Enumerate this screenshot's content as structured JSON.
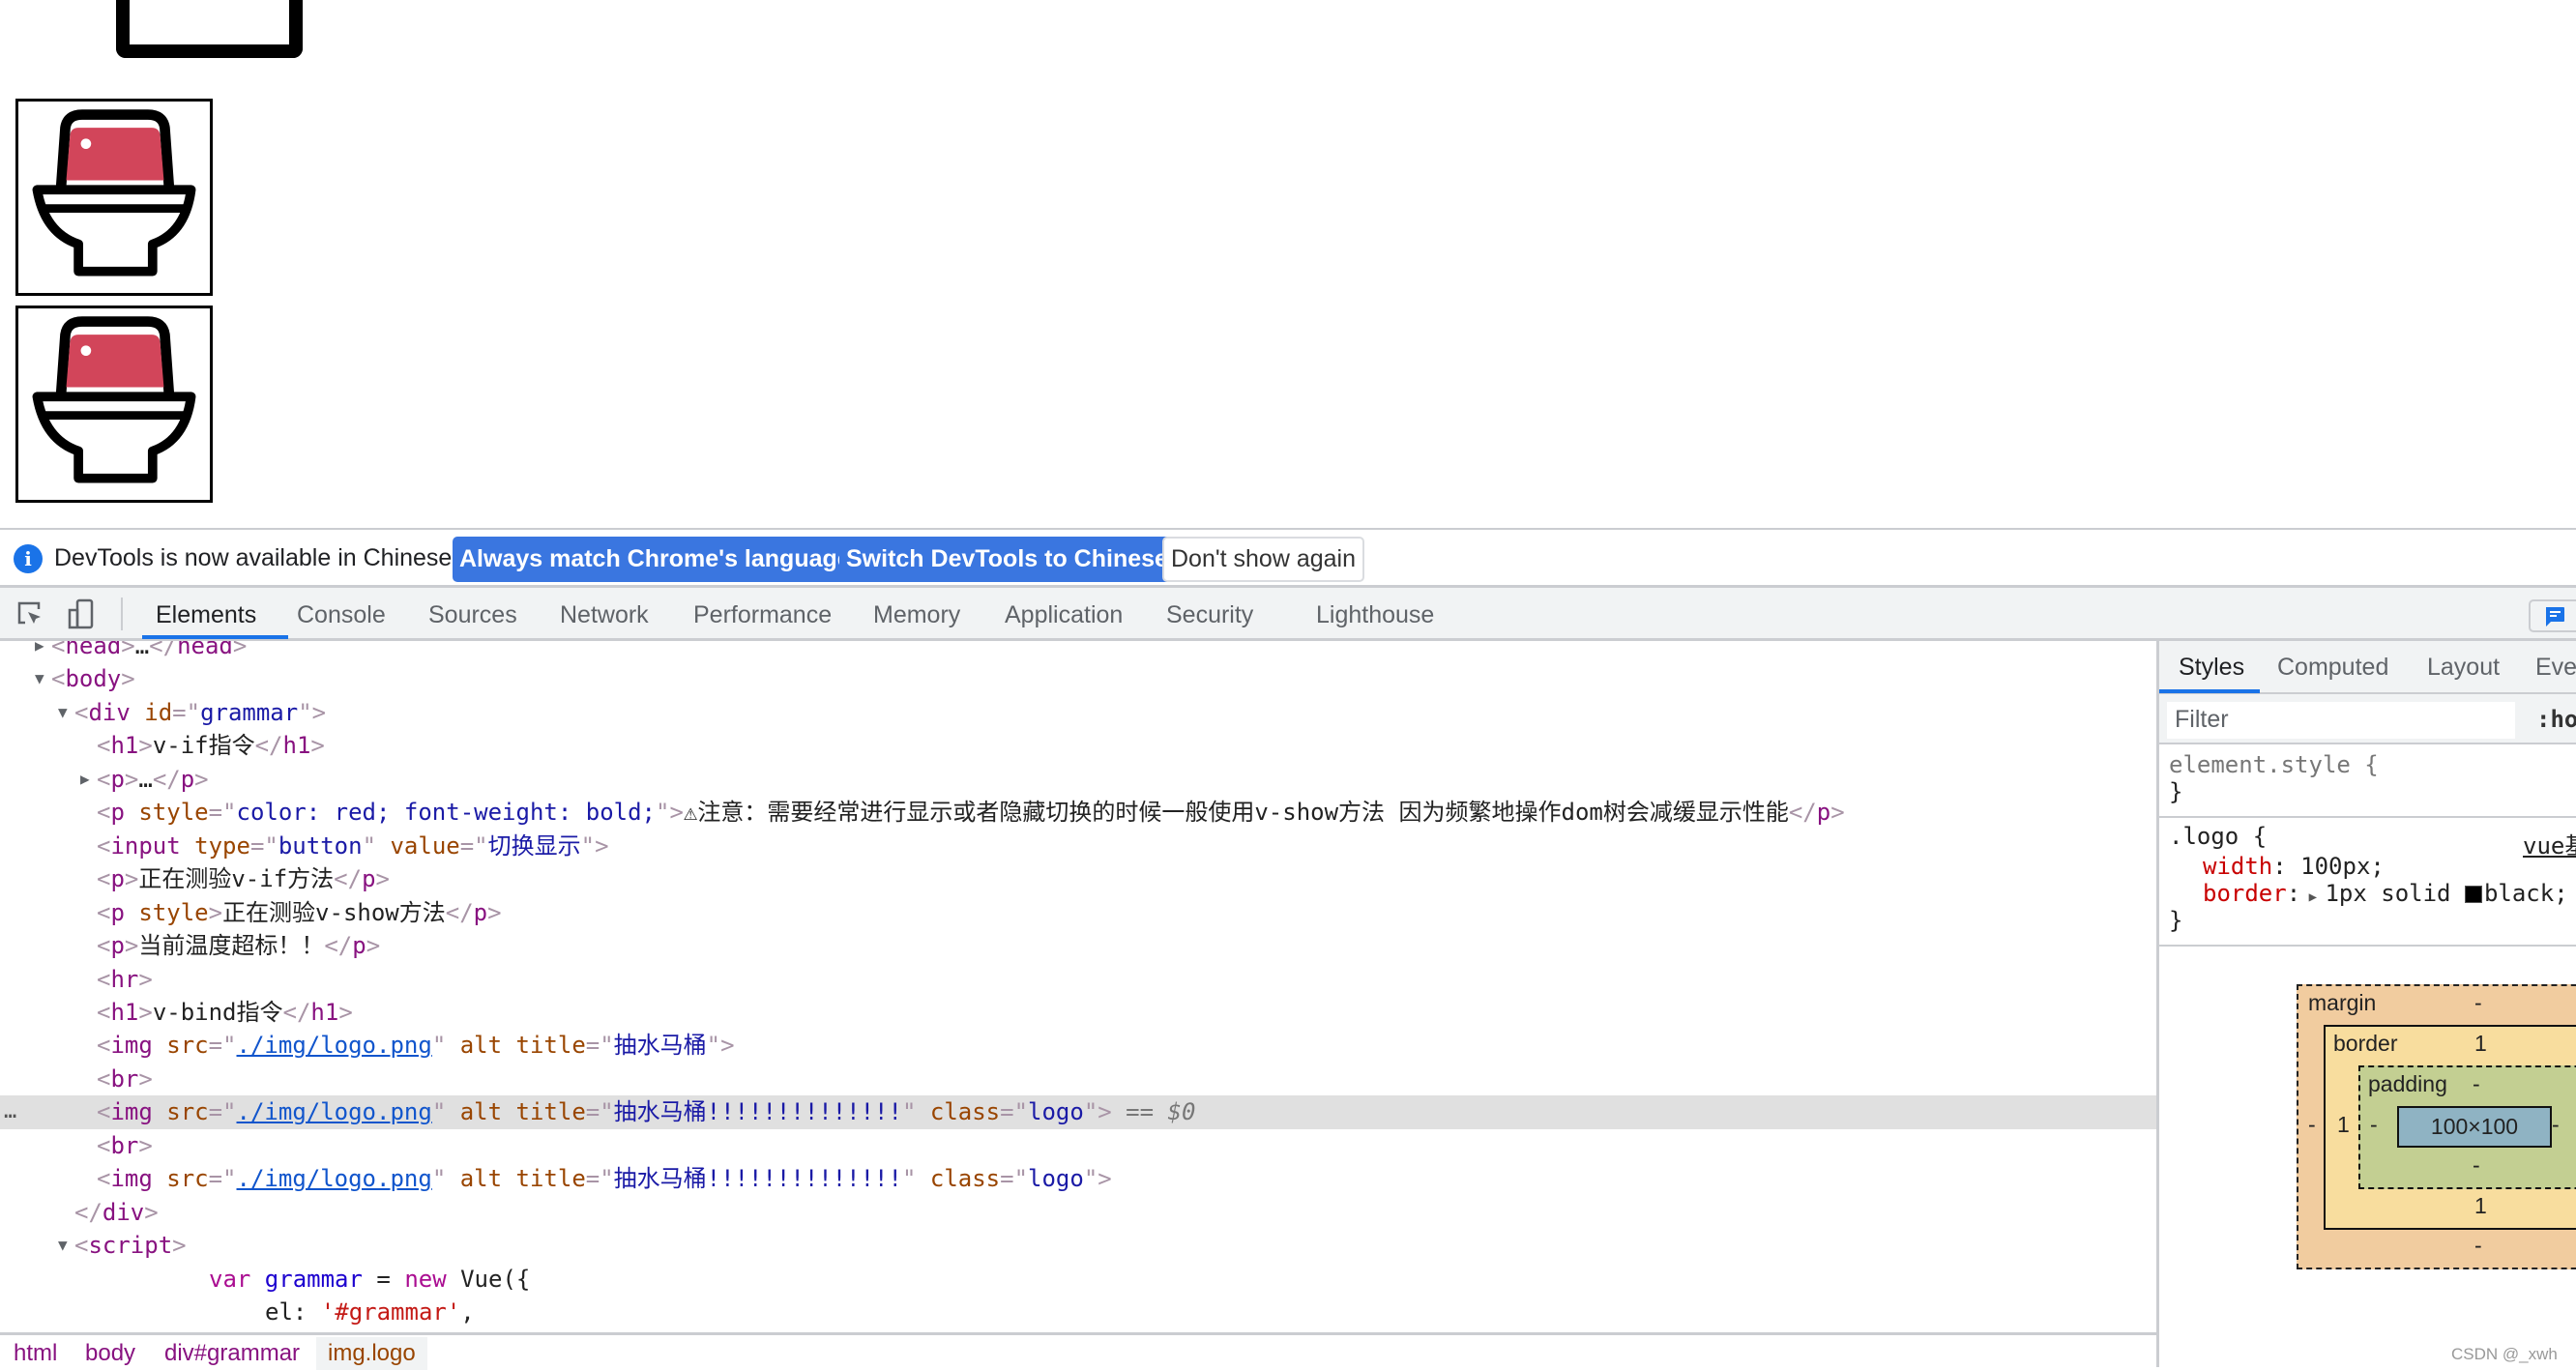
{
  "page": {
    "images": [
      {
        "title": "抽水马桶"
      },
      {
        "title": "抽水马桶!!!!!!!!!!!!!!"
      },
      {
        "title": "抽水马桶!!!!!!!!!!!!!!"
      }
    ],
    "toilet_colors": {
      "tank": "#d2455a",
      "stroke": "#000000"
    }
  },
  "banner": {
    "icon": "info-icon",
    "message": "DevTools is now available in Chinese!",
    "buttons": [
      "Always match Chrome's language",
      "Switch DevTools to Chinese",
      "Don't show again"
    ],
    "accent": "#3a76e0"
  },
  "toolbar": {
    "icons": [
      "inspect-element-icon",
      "device-toolbar-icon"
    ],
    "tabs": [
      "Elements",
      "Console",
      "Sources",
      "Network",
      "Performance",
      "Memory",
      "Application",
      "Security",
      "Lighthouse"
    ],
    "active_tab": "Elements",
    "right_icon": "feedback-chat-icon"
  },
  "dom_tree": {
    "lines": [
      {
        "depth": 0,
        "arrow": "right",
        "parts": [
          [
            "p",
            "<"
          ],
          [
            "tag",
            "head"
          ],
          [
            "p",
            ">"
          ],
          [
            "txt",
            "…"
          ],
          [
            "p",
            "</"
          ],
          [
            "tag",
            "head"
          ],
          [
            "p",
            ">"
          ]
        ]
      },
      {
        "depth": 0,
        "arrow": "down",
        "parts": [
          [
            "p",
            "<"
          ],
          [
            "tag",
            "body"
          ],
          [
            "p",
            ">"
          ]
        ]
      },
      {
        "depth": 1,
        "arrow": "down",
        "parts": [
          [
            "p",
            "<"
          ],
          [
            "tag",
            "div "
          ],
          [
            "an",
            "id"
          ],
          [
            "p",
            "=\""
          ],
          [
            "av",
            "grammar"
          ],
          [
            "p",
            "\">"
          ]
        ]
      },
      {
        "depth": 2,
        "parts": [
          [
            "p",
            "<"
          ],
          [
            "tag",
            "h1"
          ],
          [
            "p",
            ">"
          ],
          [
            "txt",
            "v-if指令"
          ],
          [
            "p",
            "</"
          ],
          [
            "tag",
            "h1"
          ],
          [
            "p",
            ">"
          ]
        ]
      },
      {
        "depth": 2,
        "arrow": "right",
        "parts": [
          [
            "p",
            "<"
          ],
          [
            "tag",
            "p"
          ],
          [
            "p",
            ">"
          ],
          [
            "txt",
            "…"
          ],
          [
            "p",
            "</"
          ],
          [
            "tag",
            "p"
          ],
          [
            "p",
            ">"
          ]
        ]
      },
      {
        "depth": 2,
        "parts": [
          [
            "p",
            "<"
          ],
          [
            "tag",
            "p "
          ],
          [
            "an",
            "style"
          ],
          [
            "p",
            "=\""
          ],
          [
            "av",
            "color: red; font-weight: bold;"
          ],
          [
            "p",
            "\">"
          ],
          [
            "txt",
            "⚠注意：需要经常进行显示或者隐藏切换的时候一般使用v-show方法 因为频繁地操作dom树会减缓显示性能"
          ],
          [
            "p",
            "</"
          ],
          [
            "tag",
            "p"
          ],
          [
            "p",
            ">"
          ]
        ]
      },
      {
        "depth": 2,
        "parts": [
          [
            "p",
            "<"
          ],
          [
            "tag",
            "input "
          ],
          [
            "an",
            "type"
          ],
          [
            "p",
            "=\""
          ],
          [
            "av",
            "button"
          ],
          [
            "p",
            "\" "
          ],
          [
            "an",
            "value"
          ],
          [
            "p",
            "=\""
          ],
          [
            "av",
            "切换显示"
          ],
          [
            "p",
            "\">"
          ]
        ]
      },
      {
        "depth": 2,
        "parts": [
          [
            "p",
            "<"
          ],
          [
            "tag",
            "p"
          ],
          [
            "p",
            ">"
          ],
          [
            "txt",
            "正在测验v-if方法"
          ],
          [
            "p",
            "</"
          ],
          [
            "tag",
            "p"
          ],
          [
            "p",
            ">"
          ]
        ]
      },
      {
        "depth": 2,
        "parts": [
          [
            "p",
            "<"
          ],
          [
            "tag",
            "p "
          ],
          [
            "an",
            "style"
          ],
          [
            "p",
            ">"
          ],
          [
            "txt",
            "正在测验v-show方法"
          ],
          [
            "p",
            "</"
          ],
          [
            "tag",
            "p"
          ],
          [
            "p",
            ">"
          ]
        ]
      },
      {
        "depth": 2,
        "parts": [
          [
            "p",
            "<"
          ],
          [
            "tag",
            "p"
          ],
          [
            "p",
            ">"
          ],
          [
            "txt",
            "当前温度超标！！"
          ],
          [
            "p",
            "</"
          ],
          [
            "tag",
            "p"
          ],
          [
            "p",
            ">"
          ]
        ]
      },
      {
        "depth": 2,
        "parts": [
          [
            "p",
            "<"
          ],
          [
            "tag",
            "hr"
          ],
          [
            "p",
            ">"
          ]
        ]
      },
      {
        "depth": 2,
        "parts": [
          [
            "p",
            "<"
          ],
          [
            "tag",
            "h1"
          ],
          [
            "p",
            ">"
          ],
          [
            "txt",
            "v-bind指令"
          ],
          [
            "p",
            "</"
          ],
          [
            "tag",
            "h1"
          ],
          [
            "p",
            ">"
          ]
        ]
      },
      {
        "depth": 2,
        "parts": [
          [
            "p",
            "<"
          ],
          [
            "tag",
            "img "
          ],
          [
            "an",
            "src"
          ],
          [
            "p",
            "=\""
          ],
          [
            "link",
            "./img/logo.png"
          ],
          [
            "p",
            "\" "
          ],
          [
            "an",
            "alt title"
          ],
          [
            "p",
            "=\""
          ],
          [
            "av",
            "抽水马桶"
          ],
          [
            "p",
            "\">"
          ]
        ]
      },
      {
        "depth": 2,
        "parts": [
          [
            "p",
            "<"
          ],
          [
            "tag",
            "br"
          ],
          [
            "p",
            ">"
          ]
        ]
      },
      {
        "depth": 2,
        "selected": true,
        "parts": [
          [
            "p",
            "<"
          ],
          [
            "tag",
            "img "
          ],
          [
            "an",
            "src"
          ],
          [
            "p",
            "=\""
          ],
          [
            "link",
            "./img/logo.png"
          ],
          [
            "p",
            "\" "
          ],
          [
            "an",
            "alt title"
          ],
          [
            "p",
            "=\""
          ],
          [
            "av",
            "抽水马桶!!!!!!!!!!!!!!"
          ],
          [
            "p",
            "\" "
          ],
          [
            "an",
            "class"
          ],
          [
            "p",
            "=\""
          ],
          [
            "av",
            "logo"
          ],
          [
            "p",
            "\">"
          ],
          [
            "dim",
            " == $0"
          ]
        ]
      },
      {
        "depth": 2,
        "parts": [
          [
            "p",
            "<"
          ],
          [
            "tag",
            "br"
          ],
          [
            "p",
            ">"
          ]
        ]
      },
      {
        "depth": 2,
        "parts": [
          [
            "p",
            "<"
          ],
          [
            "tag",
            "img "
          ],
          [
            "an",
            "src"
          ],
          [
            "p",
            "=\""
          ],
          [
            "link",
            "./img/logo.png"
          ],
          [
            "p",
            "\" "
          ],
          [
            "an",
            "alt title"
          ],
          [
            "p",
            "=\""
          ],
          [
            "av",
            "抽水马桶!!!!!!!!!!!!!!"
          ],
          [
            "p",
            "\" "
          ],
          [
            "an",
            "class"
          ],
          [
            "p",
            "=\""
          ],
          [
            "av",
            "logo"
          ],
          [
            "p",
            "\">"
          ]
        ]
      },
      {
        "depth": 1,
        "parts": [
          [
            "p",
            "</"
          ],
          [
            "tag",
            "div"
          ],
          [
            "p",
            ">"
          ]
        ]
      },
      {
        "depth": 1,
        "arrow": "down",
        "parts": [
          [
            "p",
            "<"
          ],
          [
            "tag",
            "script"
          ],
          [
            "p",
            ">"
          ]
        ]
      },
      {
        "depth": 2,
        "code": 1,
        "parts": [
          [
            "kw",
            "var "
          ],
          [
            "vn",
            "grammar"
          ],
          [
            "txt",
            " = "
          ],
          [
            "kw",
            "new "
          ],
          [
            "txt",
            "Vue({"
          ]
        ]
      },
      {
        "depth": 2,
        "code": 2,
        "parts": [
          [
            "txt",
            "el: "
          ],
          [
            "str",
            "'#grammar'"
          ],
          [
            "txt",
            ","
          ]
        ]
      }
    ],
    "selection_marker": "…"
  },
  "breadcrumbs": [
    "html",
    "body",
    "div#grammar",
    "img.logo"
  ],
  "styles_pane": {
    "tabs": [
      "Styles",
      "Computed",
      "Layout",
      "Even"
    ],
    "active_tab": "Styles",
    "filter_placeholder": "Filter",
    "hov_label": ":hov",
    "element_style": {
      "selector": "element.style {",
      "close": "}"
    },
    "rule": {
      "selector": ".logo {",
      "source": "vue基",
      "props": [
        {
          "name": "width",
          "value": "100px;"
        },
        {
          "name": "border",
          "value": "1px solid ",
          "swatch": "#000000",
          "color_name": "black;"
        }
      ],
      "close": "}"
    },
    "box_model": {
      "margin_label": "margin",
      "margin_top": "-",
      "margin_bottom": "-",
      "margin_left": "-",
      "border_label": "border",
      "border_top": "1",
      "border_bottom": "1",
      "border_left": "1",
      "padding_label": "padding",
      "padding_top": "-",
      "padding_bottom": "-",
      "padding_left": "-",
      "padding_right": "-",
      "content": "100×100",
      "colors": {
        "margin": "#f1cc9f",
        "border": "#f8dd9e",
        "padding": "#c3cf92",
        "content": "#8fb3c3"
      }
    }
  },
  "watermark": "CSDN @_xwh"
}
